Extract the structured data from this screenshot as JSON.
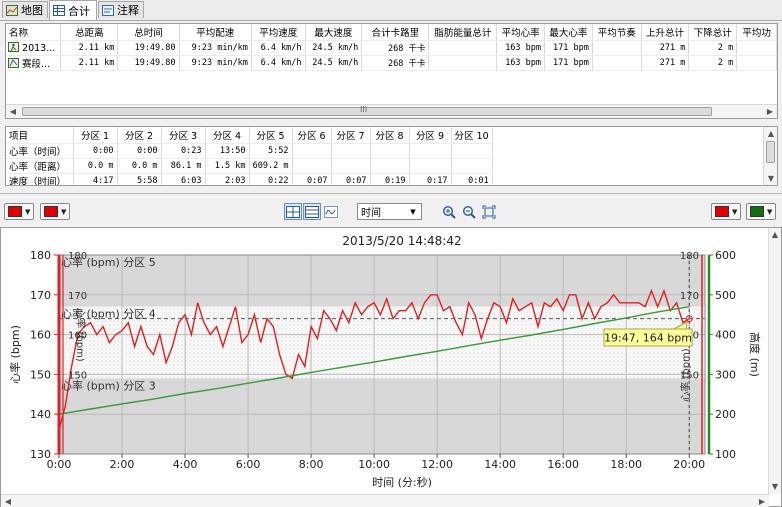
{
  "tabs": [
    {
      "label": "地图"
    },
    {
      "label": "合计"
    },
    {
      "label": "注释"
    }
  ],
  "summary": {
    "headers": [
      "名称",
      "总距离",
      "总时间",
      "平均配速",
      "平均速度",
      "最大速度",
      "合计卡路里",
      "脂肪能量总计",
      "平均心率",
      "最大心率",
      "平均节奏",
      "上升总计",
      "下降总计",
      "平均功"
    ],
    "rows": [
      {
        "icon": "activity-icon",
        "cells": [
          "2013...",
          "2.11 km",
          "19:49.80",
          "9:23 min/km",
          "6.4 km/h",
          "24.5 km/h",
          "268 千卡",
          "",
          "163 bpm",
          "171 bpm",
          "",
          "271 m",
          "2 m",
          ""
        ]
      },
      {
        "icon": "segment-icon",
        "cells": [
          "赛段...",
          "2.11 km",
          "19:49.80",
          "9:23 min/km",
          "6.4 km/h",
          "24.5 km/h",
          "268 千卡",
          "",
          "163 bpm",
          "171 bpm",
          "",
          "271 m",
          "2 m",
          ""
        ]
      }
    ],
    "scroll_grip": "III"
  },
  "zones": {
    "headers": [
      "项目",
      "分区 1",
      "分区 2",
      "分区 3",
      "分区 4",
      "分区 5",
      "分区 6",
      "分区 7",
      "分区 8",
      "分区 9",
      "分区 10"
    ],
    "rows": [
      [
        "心率（时间）",
        "0:00",
        "0:00",
        "0:23",
        "13:50",
        "5:52",
        "",
        "",
        "",
        "",
        ""
      ],
      [
        "心率（距离）",
        "0.0 m",
        "0.0 m",
        "86.1 m",
        "1.5 km",
        "609.2 m",
        "",
        "",
        "",
        "",
        ""
      ],
      [
        "速度（时间）",
        "4:17",
        "5:58",
        "6:03",
        "2:03",
        "0:22",
        "0:07",
        "0:07",
        "0:19",
        "0:17",
        "0:01"
      ]
    ]
  },
  "toolbar": {
    "left_colors": [
      "#e00000",
      "#e00000"
    ],
    "right_colors": [
      "#e00000",
      "#107010"
    ],
    "x_axis_select": "时间",
    "icons": [
      "chart-mode-icon",
      "list-mode-icon",
      "wave-mode-icon",
      "zoom-in-icon",
      "zoom-out-icon",
      "zoom-fit-icon"
    ]
  },
  "chart_data": {
    "type": "line",
    "title": "2013/5/20 14:48:42",
    "xlabel": "时间 (分:秒)",
    "ylabel_left": "心率 (bpm)",
    "ylabel_right": "高度 (m)",
    "x_ticks": [
      "0:00",
      "2:00",
      "4:00",
      "6:00",
      "8:00",
      "10:00",
      "12:00",
      "14:00",
      "16:00",
      "18:00",
      "20:00"
    ],
    "xlim": [
      0,
      20.5
    ],
    "ylim_left": [
      130,
      180
    ],
    "ylim_right": [
      100,
      600
    ],
    "left_ticks": [
      130,
      140,
      150,
      160,
      170,
      180
    ],
    "right_ticks": [
      100,
      200,
      300,
      400,
      500,
      600
    ],
    "inner_hr_ticks": [
      150,
      160,
      170,
      180
    ],
    "inner_hr_label": "心率 (bpm)",
    "grid": true,
    "zones": [
      {
        "label": "心率 (bpm) 分区 5",
        "from": 167,
        "to": 180,
        "fill": "#d8d8d8"
      },
      {
        "label": "心率 (bpm) 分区 4",
        "from": 149,
        "to": 167,
        "fill": "#f6f6f6"
      },
      {
        "label": "心率 (bpm) 分区 3",
        "from": 130,
        "to": 149,
        "fill": "#d8d8d8"
      }
    ],
    "average_hr": 164,
    "cursor": {
      "x": 20.0,
      "label": "19:47, 164 bpm"
    },
    "series": [
      {
        "name": "心率 (bpm)",
        "color": "#e02020",
        "axis": "left",
        "x": [
          0,
          0.2,
          0.4,
          0.6,
          0.8,
          1,
          1.2,
          1.4,
          1.6,
          1.8,
          2,
          2.2,
          2.4,
          2.6,
          2.8,
          3,
          3.2,
          3.4,
          3.6,
          3.8,
          4,
          4.2,
          4.4,
          4.6,
          4.8,
          5,
          5.2,
          5.4,
          5.6,
          5.8,
          6,
          6.2,
          6.4,
          6.6,
          6.8,
          7,
          7.2,
          7.4,
          7.6,
          7.8,
          8,
          8.2,
          8.4,
          8.6,
          8.8,
          9,
          9.2,
          9.4,
          9.6,
          9.8,
          10,
          10.2,
          10.4,
          10.6,
          10.8,
          11,
          11.2,
          11.4,
          11.6,
          11.8,
          12,
          12.2,
          12.4,
          12.6,
          12.8,
          13,
          13.2,
          13.4,
          13.6,
          13.8,
          14,
          14.2,
          14.4,
          14.6,
          14.8,
          15,
          15.2,
          15.4,
          15.6,
          15.8,
          16,
          16.2,
          16.4,
          16.6,
          16.8,
          17,
          17.2,
          17.4,
          17.6,
          17.8,
          18,
          18.2,
          18.4,
          18.6,
          18.8,
          19,
          19.2,
          19.4,
          19.6,
          19.8,
          20
        ],
        "values": [
          136,
          142,
          152,
          160,
          162,
          163,
          160,
          162,
          158,
          160,
          161,
          163,
          157,
          162,
          157,
          155,
          160,
          153,
          157,
          163,
          165,
          160,
          168,
          163,
          160,
          162,
          157,
          162,
          167,
          158,
          160,
          165,
          158,
          164,
          162,
          155,
          150,
          149,
          155,
          152,
          162,
          159,
          166,
          164,
          161,
          166,
          163,
          168,
          165,
          167,
          168,
          165,
          169,
          164,
          166,
          166,
          168,
          164,
          168,
          170,
          170,
          166,
          167,
          163,
          160,
          168,
          165,
          159,
          164,
          168,
          167,
          163,
          169,
          166,
          167,
          168,
          162,
          168,
          167,
          169,
          166,
          170,
          170,
          164,
          168,
          164,
          167,
          168,
          170,
          168,
          168,
          168,
          168,
          167,
          171,
          167,
          171,
          166,
          168,
          163,
          164
        ]
      },
      {
        "name": "高度 (m)",
        "color": "#3a9a3a",
        "axis": "right",
        "x": [
          0,
          1,
          2,
          3,
          4,
          5,
          6,
          7,
          8,
          9,
          10,
          11,
          12,
          13,
          14,
          15,
          16,
          17,
          18,
          19,
          20
        ],
        "values": [
          200,
          213,
          226,
          238,
          252,
          264,
          278,
          291,
          305,
          318,
          331,
          345,
          358,
          372,
          386,
          399,
          413,
          428,
          442,
          457,
          470
        ]
      }
    ]
  }
}
